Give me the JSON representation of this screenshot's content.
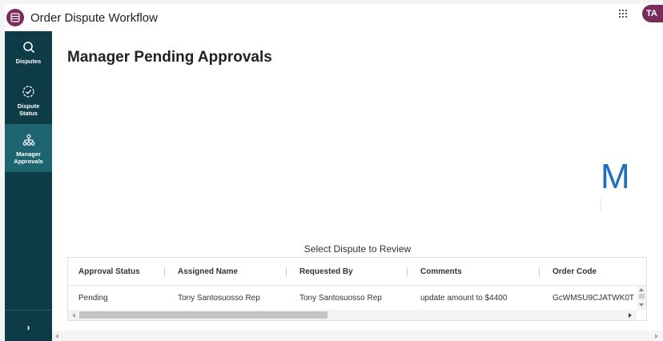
{
  "app": {
    "title": "Order Dispute Workflow",
    "icon": "app-table-icon",
    "brand_color": "#7a2c5c",
    "user_initials": "TA"
  },
  "sidebar": {
    "background": "#0d3c46",
    "active_background": "#1c6470",
    "items": [
      {
        "label": "Disputes",
        "icon": "search-icon"
      },
      {
        "label_line1": "Dispute",
        "label_line2": "Status",
        "icon": "circle-check-icon"
      },
      {
        "label_line1": "Manager",
        "label_line2": "Approvals",
        "icon": "hierarchy-icon",
        "active": true
      }
    ],
    "expand_label": "›"
  },
  "main": {
    "title": "Manager Pending Approvals",
    "logo_letter": "M",
    "table": {
      "caption": "Select Dispute to Review",
      "columns": [
        "Approval Status",
        "Assigned Name",
        "Requested By",
        "Comments",
        "Order Code"
      ],
      "rows": [
        [
          "Pending",
          "Tony Santosuosso Rep",
          "Tony Santosuosso Rep",
          "update amount to $4400",
          "GcWMSU9CJATWK0T"
        ]
      ]
    }
  }
}
